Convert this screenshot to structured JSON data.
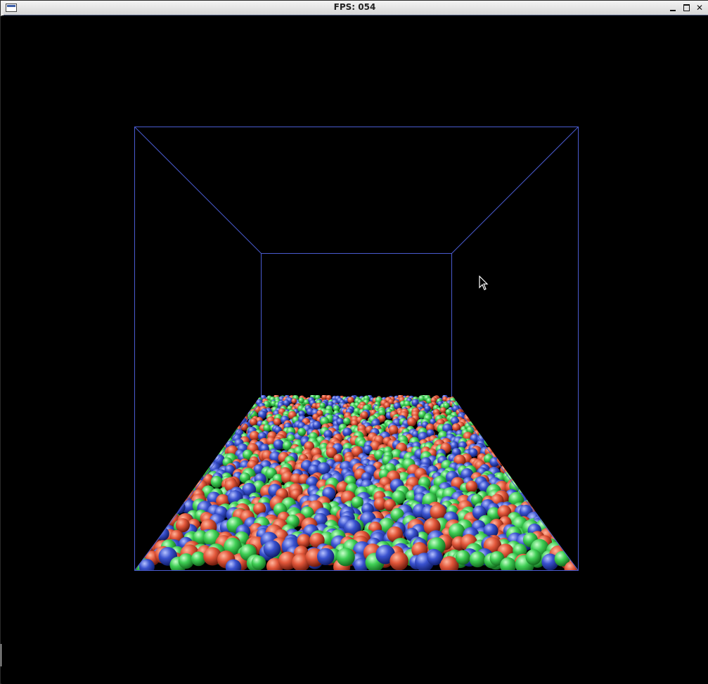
{
  "window": {
    "title": "FPS: 054",
    "icon": "app-window-icon",
    "controls": {
      "minimize_icon": "minimize-icon",
      "maximize_icon": "maximize-icon",
      "close_icon": "close-icon",
      "close_glyph": "✕"
    }
  },
  "scene": {
    "description_icon": "particle-simulation-canvas",
    "box_color": "#4a5bd0",
    "particle_colors": [
      "#e2573a",
      "#3fcf55",
      "#3a52cf"
    ],
    "background": "#000000"
  },
  "cursor": {
    "icon": "mouse-pointer-icon"
  }
}
